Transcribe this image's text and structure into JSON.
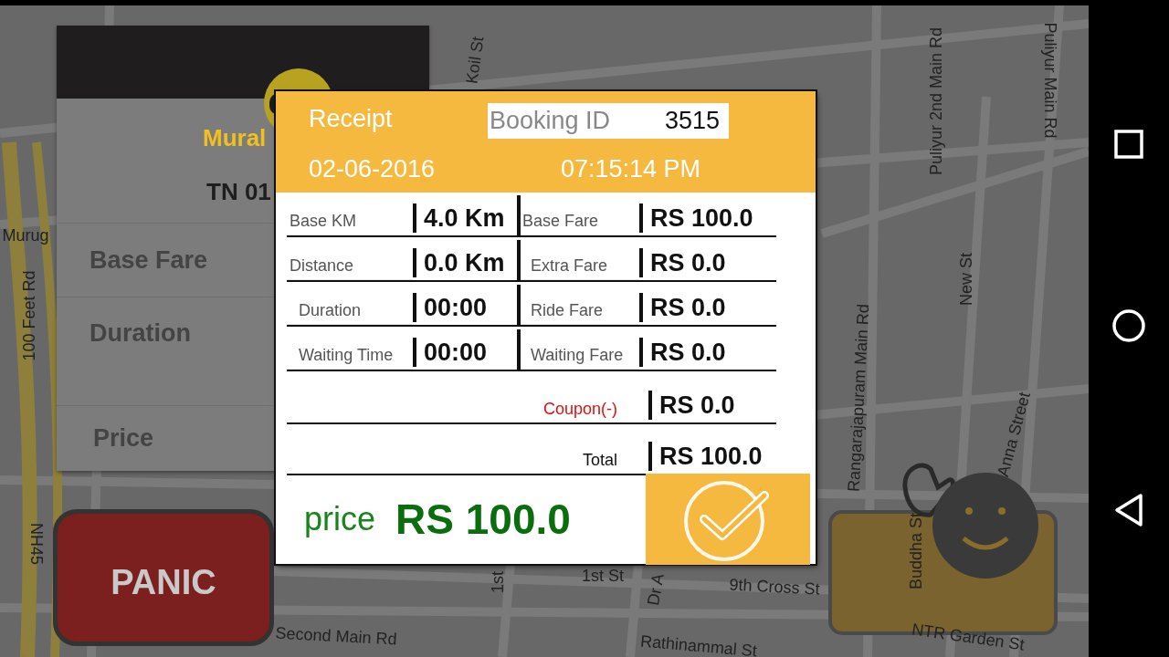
{
  "map": {
    "street_labels": [
      "Koil St",
      "Puliyur 2nd Main Rd",
      "Puliyur Main Rd",
      "New St",
      "Rangarajapuram Main Rd",
      "Anna Street",
      "Buddha St",
      "NTR Garden St",
      "9th Cross St",
      "Rathinammal St",
      "1st St",
      "1st",
      "Dr A",
      "Second Main Rd",
      "NH45",
      "100 Feet Rd",
      "Murug"
    ]
  },
  "driver_card": {
    "name": "Mural",
    "plate": "TN 01",
    "fields": [
      "Base Fare",
      "Duration",
      "Price"
    ]
  },
  "panic_button": {
    "label": "PANIC"
  },
  "receipt": {
    "title": "Receipt",
    "booking_id_label": "Booking ID",
    "booking_id": "3515",
    "date": "02-06-2016",
    "time": "07:15:14 PM",
    "rows": [
      {
        "left_label": "Base KM",
        "left_value": "4.0 Km",
        "right_label": "Base Fare",
        "right_value": "RS 100.0"
      },
      {
        "left_label": "Distance",
        "left_value": "0.0 Km",
        "right_label": "Extra Fare",
        "right_value": "RS 0.0"
      },
      {
        "left_label": "Duration",
        "left_value": "00:00",
        "right_label": "Ride Fare",
        "right_value": "RS 0.0"
      },
      {
        "left_label": "Waiting Time",
        "left_value": "00:00",
        "right_label": "Waiting Fare",
        "right_value": "RS 0.0"
      }
    ],
    "summary": [
      {
        "kind": "discount",
        "label": "Coupon(-)",
        "value": "RS 0.0"
      },
      {
        "kind": "total",
        "label": "Total",
        "value": "RS 100.0"
      }
    ],
    "price_label": "price",
    "price_value": "RS 100.0"
  }
}
